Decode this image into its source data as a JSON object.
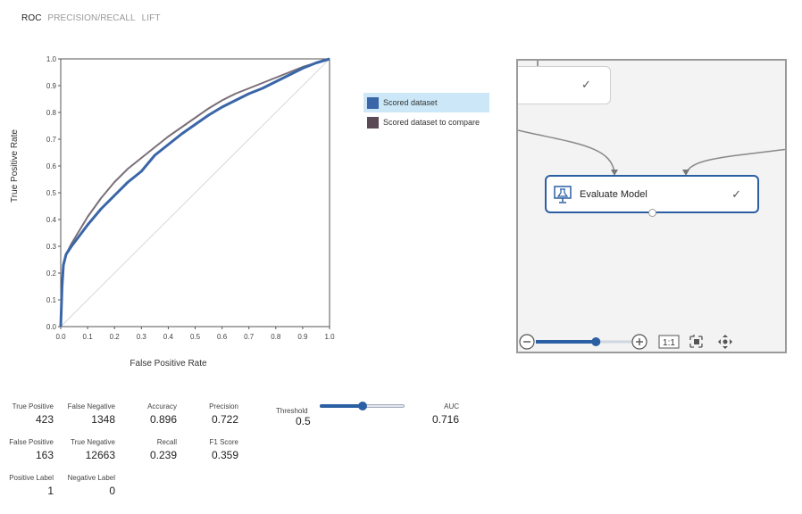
{
  "tabs": [
    {
      "label": "ROC",
      "active": true
    },
    {
      "label": "PRECISION/RECALL",
      "active": false
    },
    {
      "label": "LIFT",
      "active": false
    }
  ],
  "chart_data": {
    "type": "line",
    "title": "",
    "xlabel": "False Positive Rate",
    "ylabel": "True Positive Rate",
    "xlim": [
      0,
      1
    ],
    "ylim": [
      0,
      1
    ],
    "xticks": [
      "0.0",
      "0.1",
      "0.2",
      "0.3",
      "0.4",
      "0.5",
      "0.6",
      "0.7",
      "0.8",
      "0.9",
      "1.0"
    ],
    "yticks": [
      "0.0",
      "0.1",
      "0.2",
      "0.3",
      "0.4",
      "0.5",
      "0.6",
      "0.7",
      "0.8",
      "0.9",
      "1.0"
    ],
    "grid": false,
    "series": [
      {
        "name": "Scored dataset",
        "color": "#3a66a8",
        "x": [
          0,
          0.005,
          0.01,
          0.02,
          0.04,
          0.07,
          0.1,
          0.15,
          0.2,
          0.25,
          0.3,
          0.35,
          0.4,
          0.45,
          0.5,
          0.55,
          0.6,
          0.65,
          0.7,
          0.75,
          0.8,
          0.85,
          0.9,
          0.95,
          1.0
        ],
        "y": [
          0,
          0.15,
          0.23,
          0.27,
          0.3,
          0.34,
          0.38,
          0.44,
          0.49,
          0.54,
          0.58,
          0.64,
          0.68,
          0.72,
          0.755,
          0.79,
          0.82,
          0.845,
          0.87,
          0.89,
          0.915,
          0.94,
          0.965,
          0.985,
          1.0
        ]
      },
      {
        "name": "Scored dataset to compare",
        "color": "#7a6f78",
        "x": [
          0,
          0.005,
          0.01,
          0.02,
          0.04,
          0.07,
          0.1,
          0.15,
          0.2,
          0.25,
          0.3,
          0.35,
          0.4,
          0.45,
          0.5,
          0.55,
          0.6,
          0.65,
          0.7,
          0.75,
          0.8,
          0.85,
          0.9,
          0.95,
          1.0
        ],
        "y": [
          0,
          0.15,
          0.23,
          0.27,
          0.31,
          0.36,
          0.41,
          0.48,
          0.54,
          0.59,
          0.63,
          0.67,
          0.71,
          0.745,
          0.78,
          0.815,
          0.845,
          0.87,
          0.89,
          0.91,
          0.93,
          0.95,
          0.97,
          0.985,
          1.0
        ]
      }
    ],
    "diagonal": true
  },
  "legend": {
    "items": [
      {
        "label": "Scored dataset",
        "color": "#3a66a8",
        "selected": true
      },
      {
        "label": "Scored dataset to compare",
        "color": "#5a4a55",
        "selected": false
      }
    ]
  },
  "canvas": {
    "node_label": "Evaluate Model",
    "check_glyph": "✓",
    "zoom_fraction": 0.58,
    "one_to_one_label": "1:1"
  },
  "metrics": {
    "true_positive": {
      "label": "True Positive",
      "value": "423"
    },
    "false_negative": {
      "label": "False Negative",
      "value": "1348"
    },
    "accuracy": {
      "label": "Accuracy",
      "value": "0.896"
    },
    "precision": {
      "label": "Precision",
      "value": "0.722"
    },
    "false_positive": {
      "label": "False Positive",
      "value": "163"
    },
    "true_negative": {
      "label": "True Negative",
      "value": "12663"
    },
    "recall": {
      "label": "Recall",
      "value": "0.239"
    },
    "f1_score": {
      "label": "F1 Score",
      "value": "0.359"
    },
    "positive_label": {
      "label": "Positive Label",
      "value": "1"
    },
    "negative_label": {
      "label": "Negative Label",
      "value": "0"
    },
    "threshold": {
      "label": "Threshold",
      "value": "0.5"
    },
    "auc": {
      "label": "AUC",
      "value": "0.716"
    }
  }
}
